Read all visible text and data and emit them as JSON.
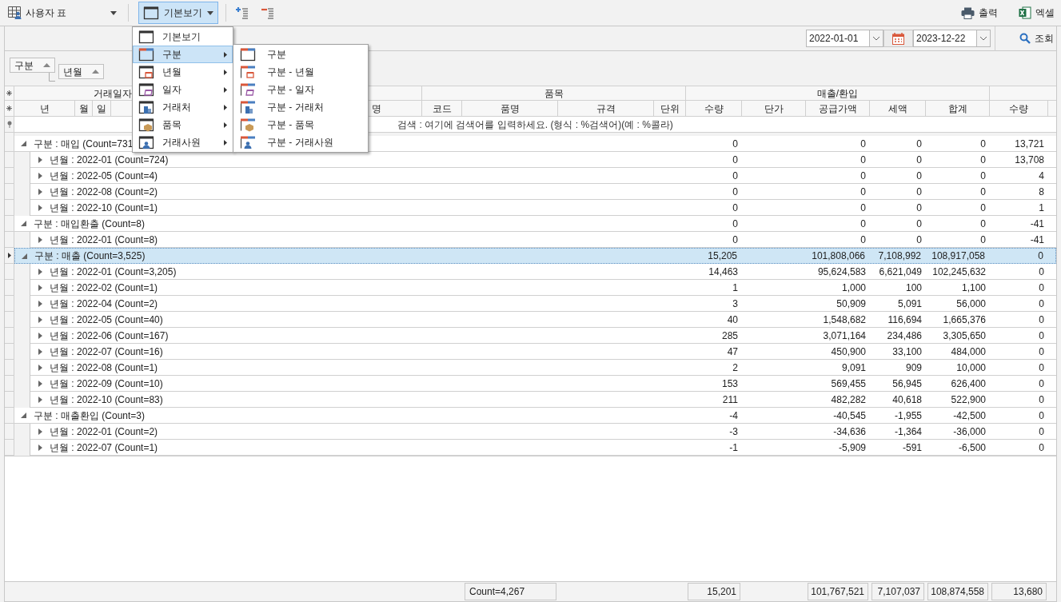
{
  "toolbar": {
    "table_selector": {
      "label": "사용자 표"
    },
    "view_button": {
      "label": "기본보기",
      "expanded": true
    },
    "row_tools": [
      {
        "kind": "add"
      },
      {
        "kind": "remove"
      }
    ],
    "right_buttons": [
      {
        "kind": "print",
        "label": "출력"
      },
      {
        "kind": "excel",
        "label": "엑셀"
      }
    ]
  },
  "filter_bar": {
    "date_from": "2022-01-01",
    "date_to": "2023-12-22",
    "search_button": "조회"
  },
  "group_panel": [
    {
      "label": "구분"
    },
    {
      "label": "년월"
    }
  ],
  "grid": {
    "header_groups": [
      "거래일자",
      "품목",
      "매출/환입"
    ],
    "columns": [
      "년",
      "월",
      "일",
      "명",
      "코드",
      "품명",
      "규격",
      "단위",
      "수량",
      "단가",
      "공급가액",
      "세액",
      "합계",
      "수량"
    ],
    "search_row": {
      "placeholder": "검색 : 여기에 검색어를 입력하세요. (형식 : %검색어)(예 : %콜라)"
    },
    "rows": [
      {
        "label": "구분 : 매입 (Count=731",
        "expanded": true,
        "selected": false,
        "values": [
          "0",
          "0",
          "0",
          "0",
          "13,721"
        ],
        "children": [
          {
            "label": "년월 : 2022-01 (Count=724)",
            "expanded": false,
            "selected": false,
            "values": [
              "0",
              "0",
              "0",
              "0",
              "13,708"
            ]
          },
          {
            "label": "년월 : 2022-05 (Count=4)",
            "expanded": false,
            "selected": false,
            "values": [
              "0",
              "0",
              "0",
              "0",
              "4"
            ]
          },
          {
            "label": "년월 : 2022-08 (Count=2)",
            "expanded": false,
            "selected": false,
            "values": [
              "0",
              "0",
              "0",
              "0",
              "8"
            ]
          },
          {
            "label": "년월 : 2022-10 (Count=1)",
            "expanded": false,
            "selected": false,
            "values": [
              "0",
              "0",
              "0",
              "0",
              "1"
            ]
          }
        ]
      },
      {
        "label": "구분 : 매입환출 (Count=8)",
        "expanded": true,
        "selected": false,
        "values": [
          "0",
          "0",
          "0",
          "0",
          "-41"
        ],
        "children": [
          {
            "label": "년월 : 2022-01 (Count=8)",
            "expanded": false,
            "selected": false,
            "values": [
              "0",
              "0",
              "0",
              "0",
              "-41"
            ]
          }
        ]
      },
      {
        "label": "구분 : 매출 (Count=3,525)",
        "expanded": true,
        "selected": true,
        "values": [
          "15,205",
          "101,808,066",
          "7,108,992",
          "108,917,058",
          "0"
        ],
        "children": [
          {
            "label": "년월 : 2022-01 (Count=3,205)",
            "expanded": false,
            "selected": false,
            "values": [
              "14,463",
              "95,624,583",
              "6,621,049",
              "102,245,632",
              "0"
            ]
          },
          {
            "label": "년월 : 2022-02 (Count=1)",
            "expanded": false,
            "selected": false,
            "values": [
              "1",
              "1,000",
              "100",
              "1,100",
              "0"
            ]
          },
          {
            "label": "년월 : 2022-04 (Count=2)",
            "expanded": false,
            "selected": false,
            "values": [
              "3",
              "50,909",
              "5,091",
              "56,000",
              "0"
            ]
          },
          {
            "label": "년월 : 2022-05 (Count=40)",
            "expanded": false,
            "selected": false,
            "values": [
              "40",
              "1,548,682",
              "116,694",
              "1,665,376",
              "0"
            ]
          },
          {
            "label": "년월 : 2022-06 (Count=167)",
            "expanded": false,
            "selected": false,
            "values": [
              "285",
              "3,071,164",
              "234,486",
              "3,305,650",
              "0"
            ]
          },
          {
            "label": "년월 : 2022-07 (Count=16)",
            "expanded": false,
            "selected": false,
            "values": [
              "47",
              "450,900",
              "33,100",
              "484,000",
              "0"
            ]
          },
          {
            "label": "년월 : 2022-08 (Count=1)",
            "expanded": false,
            "selected": false,
            "values": [
              "2",
              "9,091",
              "909",
              "10,000",
              "0"
            ]
          },
          {
            "label": "년월 : 2022-09 (Count=10)",
            "expanded": false,
            "selected": false,
            "values": [
              "153",
              "569,455",
              "56,945",
              "626,400",
              "0"
            ]
          },
          {
            "label": "년월 : 2022-10 (Count=83)",
            "expanded": false,
            "selected": false,
            "values": [
              "211",
              "482,282",
              "40,618",
              "522,900",
              "0"
            ]
          }
        ]
      },
      {
        "label": "구분 : 매출환입 (Count=3)",
        "expanded": true,
        "selected": false,
        "values": [
          "-4",
          "-40,545",
          "-1,955",
          "-42,500",
          "0"
        ],
        "children": [
          {
            "label": "년월 : 2022-01 (Count=2)",
            "expanded": false,
            "selected": false,
            "values": [
              "-3",
              "-34,636",
              "-1,364",
              "-36,000",
              "0"
            ]
          },
          {
            "label": "년월 : 2022-07 (Count=1)",
            "expanded": false,
            "selected": false,
            "values": [
              "-1",
              "-5,909",
              "-591",
              "-6,500",
              "0"
            ]
          }
        ]
      }
    ],
    "footer": {
      "count": "Count=4,267",
      "totals": [
        "15,201",
        "101,767,521",
        "7,107,037",
        "108,874,558",
        "13,680"
      ]
    }
  },
  "view_menu": {
    "items": [
      {
        "label": "기본보기",
        "kind": "basic",
        "selected": false,
        "submenu": false
      },
      {
        "label": "구분",
        "kind": "category",
        "selected": true,
        "submenu": true
      },
      {
        "label": "년월",
        "kind": "month",
        "selected": false,
        "submenu": true
      },
      {
        "label": "일자",
        "kind": "day",
        "selected": false,
        "submenu": true
      },
      {
        "label": "거래처",
        "kind": "client",
        "selected": false,
        "submenu": true
      },
      {
        "label": "품목",
        "kind": "item",
        "selected": false,
        "submenu": true
      },
      {
        "label": "거래사원",
        "kind": "staff",
        "selected": false,
        "submenu": true
      }
    ],
    "submenu": [
      {
        "label": "구분",
        "kind": "category"
      },
      {
        "label": "구분 - 년월",
        "kind": "category-month"
      },
      {
        "label": "구분 - 일자",
        "kind": "category-day"
      },
      {
        "label": "구분 - 거래처",
        "kind": "category-client"
      },
      {
        "label": "구분 - 품목",
        "kind": "category-item"
      },
      {
        "label": "구분 - 거래사원",
        "kind": "category-staff"
      }
    ]
  }
}
